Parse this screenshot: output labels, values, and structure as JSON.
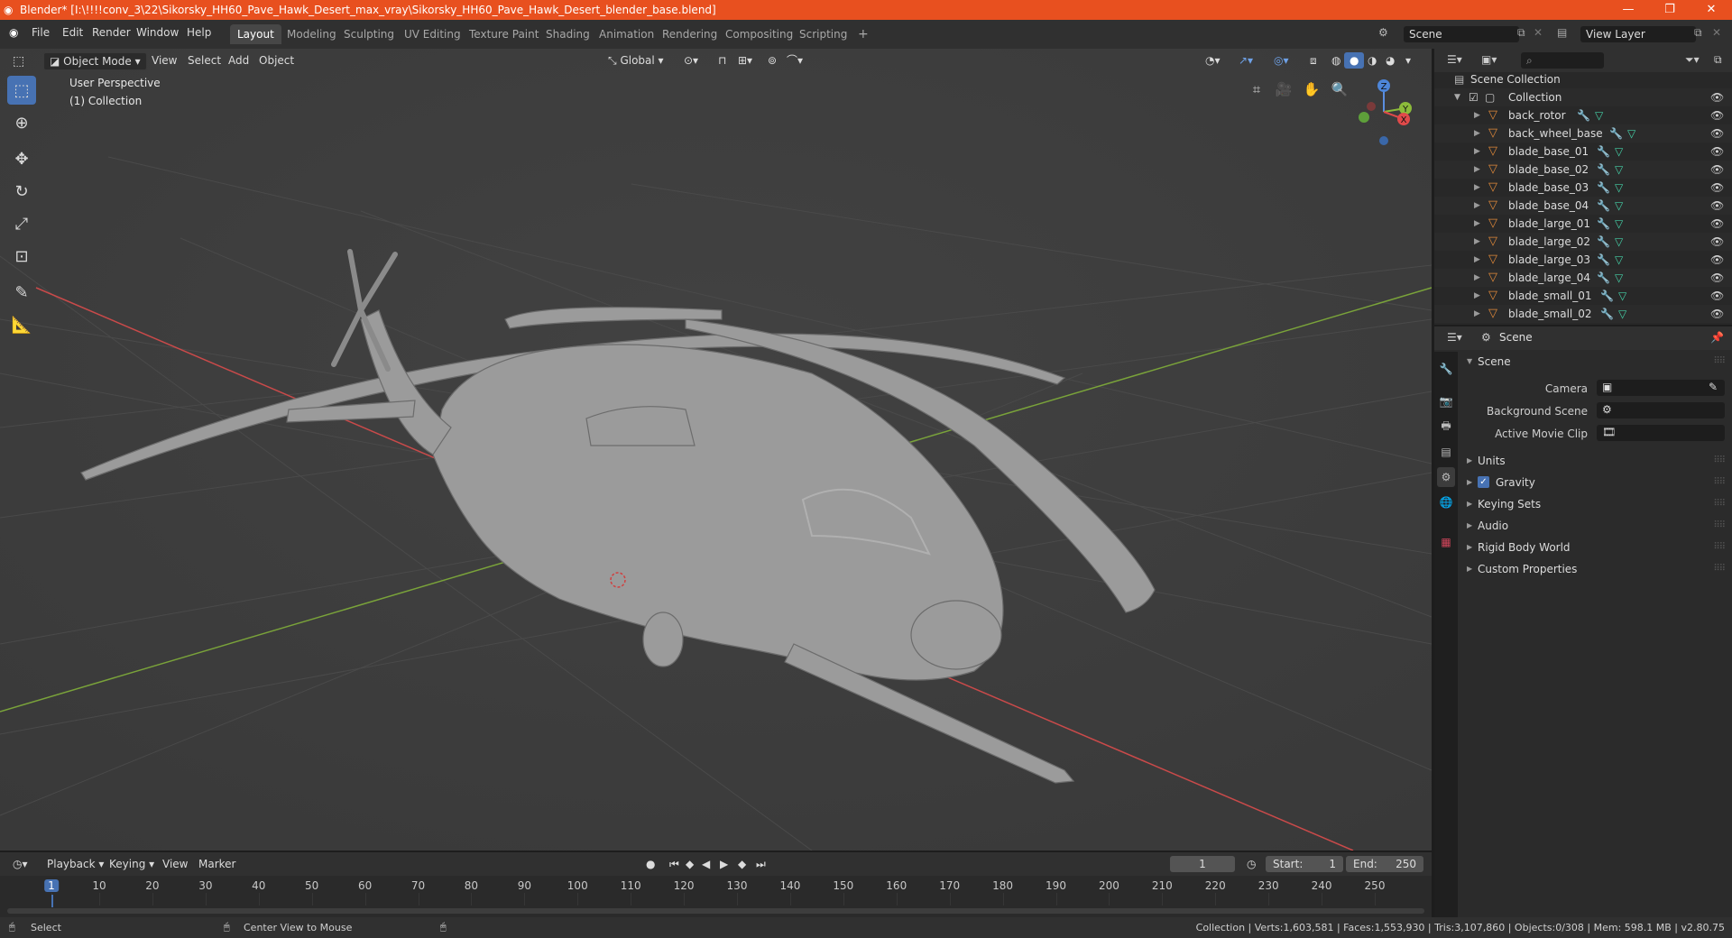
{
  "window": {
    "title": "Blender* [I:\\!!!!conv_3\\22\\Sikorsky_HH60_Pave_Hawk_Desert_max_vray\\Sikorsky_HH60_Pave_Hawk_Desert_blender_base.blend]",
    "controls": [
      "—",
      "❐",
      "✕"
    ]
  },
  "menubar": {
    "menus": [
      "File",
      "Edit",
      "Render",
      "Window",
      "Help"
    ],
    "workspaces": [
      "Layout",
      "Modeling",
      "Sculpting",
      "UV Editing",
      "Texture Paint",
      "Shading",
      "Animation",
      "Rendering",
      "Compositing",
      "Scripting"
    ],
    "active_workspace": "Layout",
    "add_tab": "+",
    "scene_value": "Scene",
    "view_layer_value": "View Layer"
  },
  "viewport": {
    "mode": "Object Mode",
    "menus": [
      "View",
      "Select",
      "Add",
      "Object"
    ],
    "transform_orientation": "Global",
    "overlay_title": "User Perspective",
    "overlay_collection": "(1) Collection",
    "gizmo_axes": [
      "X",
      "Y",
      "Z"
    ]
  },
  "outliner": {
    "root": "Scene Collection",
    "collection": "Collection",
    "objects": [
      "back_rotor",
      "back_wheel_base",
      "blade_base_01",
      "blade_base_02",
      "blade_base_03",
      "blade_base_04",
      "blade_large_01",
      "blade_large_02",
      "blade_large_03",
      "blade_large_04",
      "blade_small_01",
      "blade_small_02"
    ]
  },
  "properties": {
    "context": "Scene",
    "section": "Scene",
    "fields": [
      {
        "label": "Camera",
        "value": ""
      },
      {
        "label": "Background Scene",
        "value": ""
      },
      {
        "label": "Active Movie Clip",
        "value": ""
      }
    ],
    "panels": [
      "Units",
      "Gravity",
      "Keying Sets",
      "Audio",
      "Rigid Body World",
      "Custom Properties"
    ],
    "gravity_checked": true
  },
  "timeline": {
    "menus": [
      "Playback",
      "Keying",
      "View",
      "Marker"
    ],
    "current_frame": "1",
    "start_label": "Start:",
    "start": "1",
    "end_label": "End:",
    "end": "250",
    "ruler": [
      "1",
      "10",
      "20",
      "30",
      "40",
      "50",
      "60",
      "70",
      "80",
      "90",
      "100",
      "110",
      "120",
      "130",
      "140",
      "150",
      "160",
      "170",
      "180",
      "190",
      "200",
      "210",
      "220",
      "230",
      "240",
      "250"
    ]
  },
  "statusbar": {
    "left_action": "Select",
    "mid_action": "Center View to Mouse",
    "stats": "Collection | Verts:1,603,581 | Faces:1,553,930 | Tris:3,107,860 | Objects:0/308 | Mem: 598.1 MB | v2.80.75"
  },
  "colors": {
    "titlebar": "#e8501f",
    "accent_blue": "#4772b3",
    "object_orange": "#e0893a",
    "mesh_green": "#45d0a7",
    "x_axis": "#c94a4a",
    "y_axis": "#7aa33a"
  }
}
